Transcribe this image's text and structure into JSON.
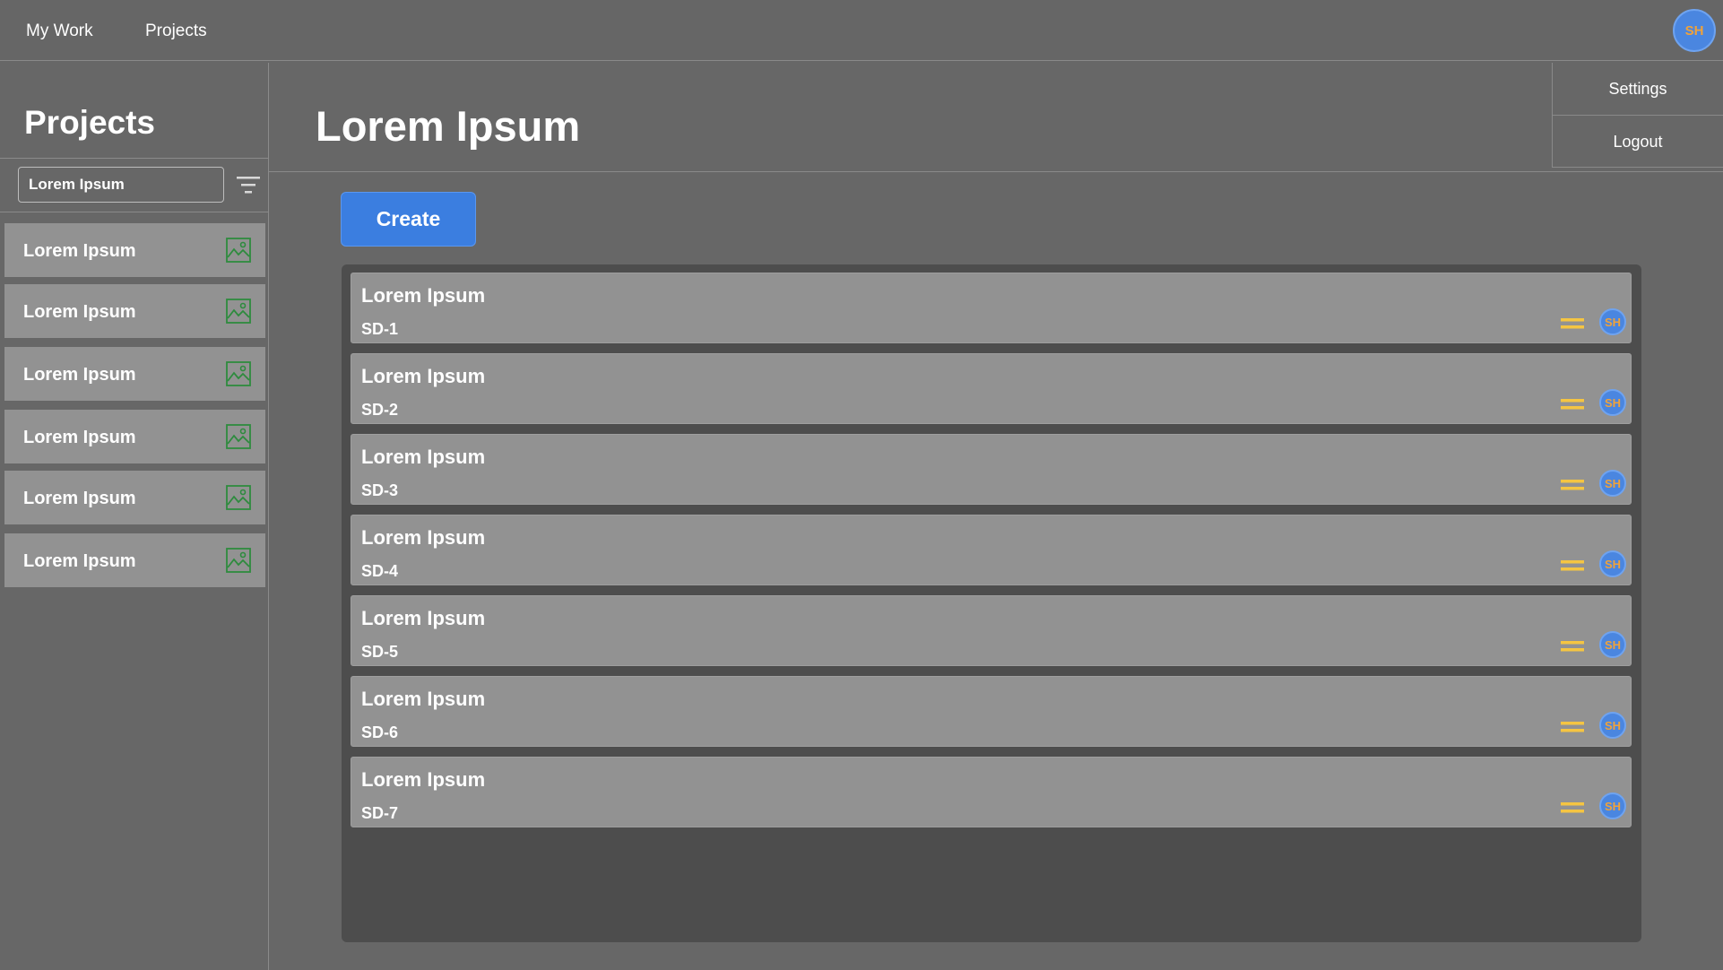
{
  "topbar": {
    "nav": [
      "My Work",
      "Projects"
    ],
    "avatar": "SH"
  },
  "sidebar": {
    "title": "Projects",
    "search_value": "Lorem Ipsum",
    "filter_icon": "filter-icon",
    "items": [
      {
        "label": "Lorem Ipsum",
        "icon": "image-icon"
      },
      {
        "label": "Lorem Ipsum",
        "icon": "image-icon"
      },
      {
        "label": "Lorem Ipsum",
        "icon": "image-icon"
      },
      {
        "label": "Lorem Ipsum",
        "icon": "image-icon"
      },
      {
        "label": "Lorem Ipsum",
        "icon": "image-icon"
      },
      {
        "label": "Lorem Ipsum",
        "icon": "image-icon"
      }
    ]
  },
  "main": {
    "title": "Lorem Ipsum",
    "create_label": "Create"
  },
  "menu": {
    "items": [
      "Settings",
      "Logout"
    ]
  },
  "board": {
    "cards": [
      {
        "title": "Lorem Ipsum",
        "key": "SD-1",
        "assignee": "SH",
        "priority": "medium"
      },
      {
        "title": "Lorem Ipsum",
        "key": "SD-2",
        "assignee": "SH",
        "priority": "medium"
      },
      {
        "title": "Lorem Ipsum",
        "key": "SD-3",
        "assignee": "SH",
        "priority": "medium"
      },
      {
        "title": "Lorem Ipsum",
        "key": "SD-4",
        "assignee": "SH",
        "priority": "medium"
      },
      {
        "title": "Lorem Ipsum",
        "key": "SD-5",
        "assignee": "SH",
        "priority": "medium"
      },
      {
        "title": "Lorem Ipsum",
        "key": "SD-6",
        "assignee": "SH",
        "priority": "medium"
      },
      {
        "title": "Lorem Ipsum",
        "key": "SD-7",
        "assignee": "SH",
        "priority": "medium"
      }
    ]
  },
  "colors": {
    "background": "#676767",
    "item_bg": "#929292",
    "board_bg": "#4d4d4d",
    "accent": "#3b7ee0",
    "avatar_text": "#f0a23a",
    "priority": "#f5c542",
    "image_icon": "#2e8b3e"
  }
}
